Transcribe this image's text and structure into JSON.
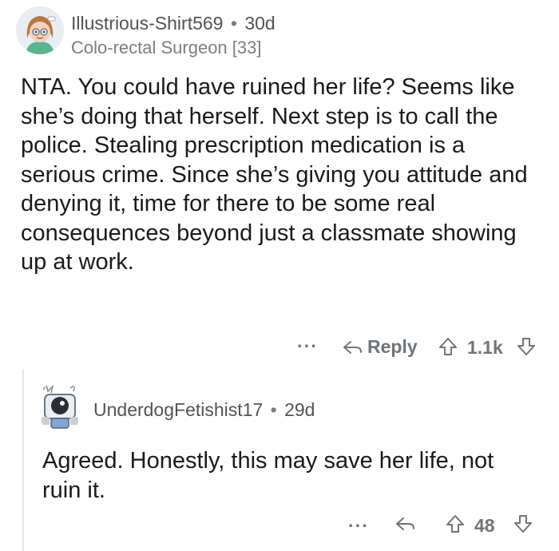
{
  "comment": {
    "username": "Illustrious-Shirt569",
    "separator": "•",
    "age": "30d",
    "flair": "Colo-rectal Surgeon [33]",
    "body": "NTA. You could have ruined her life? Seems like she’s doing that herself. Next step is to call the police. Stealing prescription medication is a serious crime. Since she’s giving you attitude and denying it, time for there to be some real consequences beyond just a classmate showing up at work.",
    "actions": {
      "more": "···",
      "reply_label": "Reply",
      "score": "1.1k"
    }
  },
  "reply": {
    "username": "UnderdogFetishist17",
    "separator": "•",
    "age": "29d",
    "body": "Agreed. Honestly, this may save her life, not ruin it.",
    "actions": {
      "more": "···",
      "score": "48"
    }
  },
  "icons": {
    "avatar_1": "cartoon-girl-avatar",
    "avatar_2": "robot-avatar",
    "reply": "reply-arrow-icon",
    "upvote": "upvote-arrow-icon",
    "downvote": "downvote-arrow-icon"
  },
  "colors": {
    "text": "#1a1a1b",
    "muted": "#6f7478",
    "thread_line": "#e4e6e8"
  }
}
